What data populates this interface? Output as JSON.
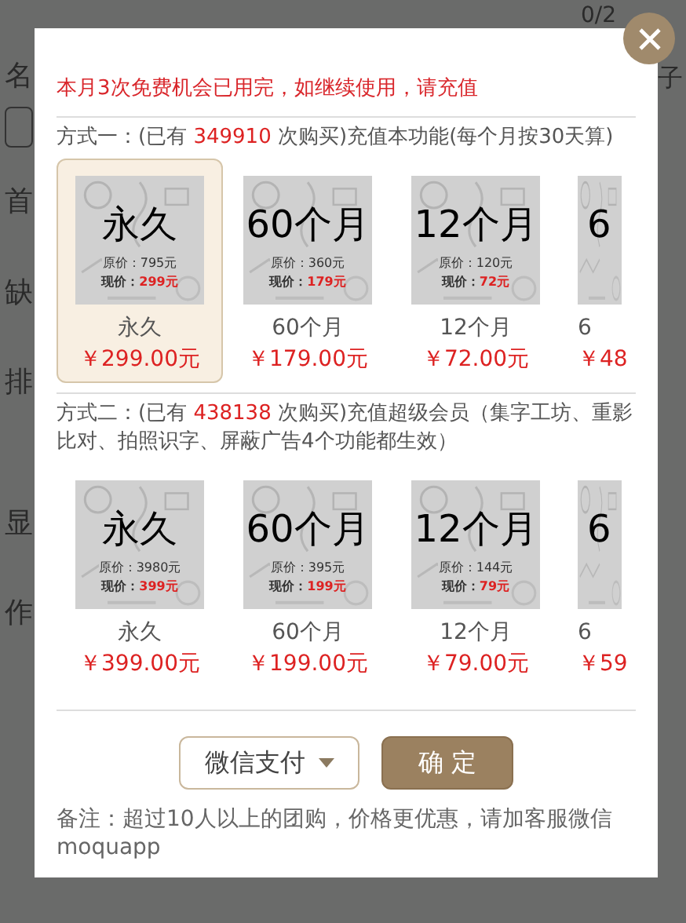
{
  "background": {
    "counter": "0/2",
    "right_label": "子",
    "side_labels": [
      "名",
      "首",
      "缺",
      "排",
      "显",
      "作"
    ]
  },
  "notice": "本月3次免费机会已用完，如继续使用，请充值",
  "plans": [
    {
      "intro_prefix": "方式一：(已有 ",
      "count": "349910",
      "intro_suffix": " 次购买)充值本功能(每个月按30天算)",
      "options": [
        {
          "kind": "full",
          "selected": true,
          "image_title": "永久",
          "original_price": "原价：795元",
          "current_label": "现价：",
          "current_price": "299元",
          "label": "永久",
          "price": "￥299.00元"
        },
        {
          "kind": "full",
          "selected": false,
          "image_title": "60个月",
          "original_price": "原价：360元",
          "current_label": "现价：",
          "current_price": "179元",
          "label": "60个月",
          "price": "￥179.00元"
        },
        {
          "kind": "full",
          "selected": false,
          "image_title": "12个月",
          "original_price": "原价：120元",
          "current_label": "现价：",
          "current_price": "72元",
          "label": "12个月",
          "price": "￥72.00元"
        },
        {
          "kind": "partial",
          "selected": false,
          "image_title": "6",
          "label": "6",
          "price": "￥48"
        }
      ]
    },
    {
      "intro_prefix": "方式二：(已有 ",
      "count": "438138",
      "intro_suffix": " 次购买)充值超级会员（集字工坊、重影比对、拍照识字、屏蔽广告4个功能都生效）",
      "options": [
        {
          "kind": "full",
          "selected": false,
          "image_title": "永久",
          "original_price": "原价：3980元",
          "current_label": "现价：",
          "current_price": "399元",
          "label": "永久",
          "price": "￥399.00元"
        },
        {
          "kind": "full",
          "selected": false,
          "image_title": "60个月",
          "original_price": "原价：395元",
          "current_label": "现价：",
          "current_price": "199元",
          "label": "60个月",
          "price": "￥199.00元"
        },
        {
          "kind": "full",
          "selected": false,
          "image_title": "12个月",
          "original_price": "原价：144元",
          "current_label": "现价：",
          "current_price": "79元",
          "label": "12个月",
          "price": "￥79.00元"
        },
        {
          "kind": "partial",
          "selected": false,
          "image_title": "6",
          "label": "6",
          "price": "￥59"
        }
      ]
    }
  ],
  "payment": {
    "method": "微信支付",
    "confirm": "确 定"
  },
  "footnote": "备注：超过10人以上的团购，价格更优惠，请加客服微信moquapp"
}
